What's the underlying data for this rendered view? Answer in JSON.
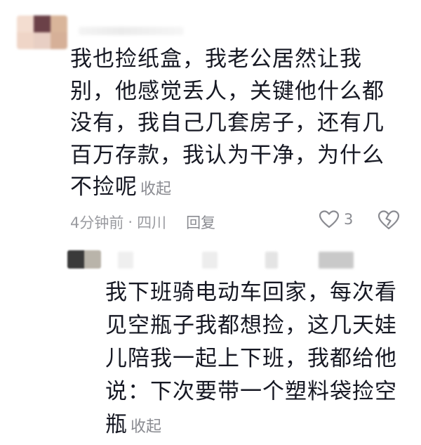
{
  "comment": {
    "text": "我也捡纸盒，我老公居然让我别，他感觉丢人，关键他什么都没有，我自己几套房子，还有几百万存款，我认为干净，为什么不捡呢",
    "collapse_label": "收起",
    "time": "4分钟前",
    "separator": "·",
    "location": "四川",
    "reply_label": "回复",
    "like_count": "3",
    "like_icon": "heart-outline-icon",
    "dislike_icon": "broken-heart-icon"
  },
  "reply_comment": {
    "text": "我下班骑电动车回家，每次看见空瓶子我都想捡，这几天娃儿陪我一起上下班，我都给他说：下次要带一个塑料袋捡空瓶",
    "collapse_label": "收起"
  },
  "colors": {
    "text_primary": "#161823",
    "text_secondary": "#8a8b91",
    "background": "#ffffff"
  }
}
